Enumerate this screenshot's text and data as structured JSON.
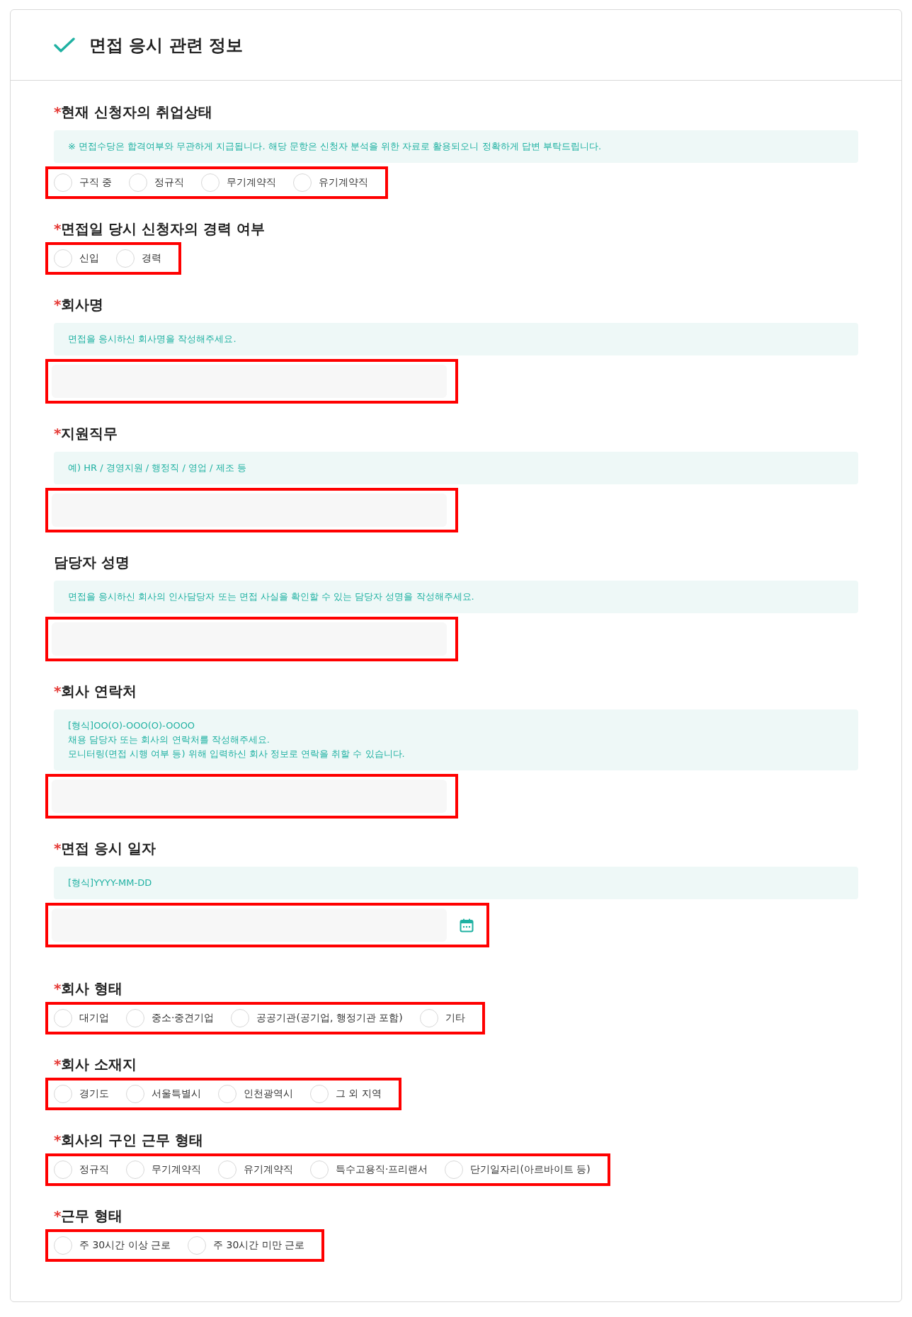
{
  "panel": {
    "title": "면접 응시 관련 정보"
  },
  "fields": [
    {
      "kind": "radio",
      "marker": "*",
      "label": "현재 신청자의 취업상태",
      "hint": [
        "※ 면접수당은 합격여부와 무관하게 지급됩니다. 해당 문항은 신청자 분석을 위한 자료로 활용되오니 정확하게 답변 부탁드립니다."
      ],
      "highlighted": true,
      "options": [
        {
          "label": "구직 중",
          "selected": false
        },
        {
          "label": "정규직",
          "selected": false
        },
        {
          "label": "무기계약직",
          "selected": false
        },
        {
          "label": "유기계약직",
          "selected": false
        }
      ]
    },
    {
      "kind": "radio",
      "marker": "*",
      "label": "면접일 당시 신청자의 경력 여부",
      "highlighted": true,
      "options": [
        {
          "label": "신입",
          "selected": false
        },
        {
          "label": "경력",
          "selected": false
        }
      ]
    },
    {
      "kind": "text",
      "marker": "*",
      "label": "회사명",
      "hint": [
        "면접을 응시하신 회사명을 작성해주세요."
      ],
      "highlighted": true
    },
    {
      "kind": "text",
      "marker": "*",
      "label": "지원직무",
      "hint": [
        "예) HR / 경영지원 / 행정직 / 영업 / 제조 등"
      ],
      "highlighted": true
    },
    {
      "kind": "text",
      "label": "담당자 성명",
      "hint": [
        "면접을 응시하신 회사의 인사담당자 또는 면접 사실을 확인할 수 있는 담당자 성명을 작성해주세요."
      ],
      "highlighted": true
    },
    {
      "kind": "text",
      "marker": "*",
      "label": "회사 연락처",
      "hint": [
        "[형식]OO(O)-OOO(O)-OOOO",
        "채용 담당자 또는 회사의 연락처를 작성해주세요.",
        "모니터링(면접 시행 여부 등) 위해 입력하신 회사 정보로 연락을 취할 수 있습니다."
      ],
      "highlighted": true
    },
    {
      "kind": "date",
      "marker": "*",
      "label": "면접 응시 일자",
      "hint": [
        "[형식]YYYY-MM-DD"
      ],
      "highlighted": true
    },
    {
      "kind": "radio",
      "marker": "*",
      "label": "회사 형태",
      "highlighted": true,
      "options": [
        {
          "label": "대기업",
          "selected": false
        },
        {
          "label": "중소·중견기업",
          "selected": false
        },
        {
          "label": "공공기관(공기업, 행정기관 포함)",
          "selected": false
        },
        {
          "label": "기타",
          "selected": false
        }
      ]
    },
    {
      "kind": "radio",
      "marker": "*",
      "label": "회사 소재지",
      "highlighted": true,
      "options": [
        {
          "label": "경기도",
          "selected": false
        },
        {
          "label": "서울특별시",
          "selected": false
        },
        {
          "label": "인천광역시",
          "selected": false
        },
        {
          "label": "그 외 지역",
          "selected": false
        }
      ]
    },
    {
      "kind": "radio",
      "marker": "*",
      "label": "회사의 구인 근무 형태",
      "highlighted": true,
      "options": [
        {
          "label": "정규직",
          "selected": false
        },
        {
          "label": "무기계약직",
          "selected": false
        },
        {
          "label": "유기계약직",
          "selected": false
        },
        {
          "label": "특수고용직·프리랜서",
          "selected": false
        },
        {
          "label": "단기일자리(아르바이트 등)",
          "selected": false
        }
      ]
    },
    {
      "kind": "radio",
      "marker": "*",
      "label": "근무 형태",
      "highlighted": true,
      "options": [
        {
          "label": "주 30시간 이상 근로",
          "selected": false
        },
        {
          "label": "주 30시간 미만 근로",
          "selected": false
        }
      ]
    }
  ]
}
